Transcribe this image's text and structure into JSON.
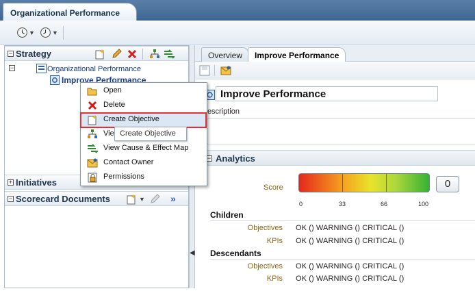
{
  "window": {
    "title_tab": "Organizational Performance"
  },
  "strategy": {
    "header": "Strategy",
    "tree": {
      "root": "Organizational Performance",
      "child": "Improve Performance"
    }
  },
  "initiatives": {
    "header": "Initiatives"
  },
  "scorecard_docs": {
    "header": "Scorecard Documents",
    "expand_label": "»"
  },
  "context_menu": {
    "items": [
      {
        "label": "Open",
        "icon": "open-folder-icon"
      },
      {
        "label": "Delete",
        "icon": "delete-x-icon"
      },
      {
        "label": "Create Objective",
        "icon": "create-objective-icon"
      },
      {
        "label": "View Strategy Tree",
        "icon": "strategy-tree-icon"
      },
      {
        "label": "View Cause & Effect Map",
        "icon": "cause-effect-map-icon"
      },
      {
        "label": "Contact Owner",
        "icon": "contact-owner-icon"
      },
      {
        "label": "Permissions",
        "icon": "permissions-icon"
      }
    ],
    "view_strategy_visible": "Vie",
    "tooltip": "Create Objective"
  },
  "right": {
    "tabs": {
      "overview": "Overview",
      "improve": "Improve Performance"
    },
    "objective_name": "Improve Performance",
    "description_label": "Description",
    "analytics_header": "Analytics",
    "score": {
      "label": "Score",
      "value": "0",
      "scale": [
        "0",
        "33",
        "66",
        "100"
      ]
    },
    "children": {
      "header": "Children",
      "rows": [
        {
          "label": "Objectives",
          "status": "OK ()  WARNING ()  CRITICAL ()"
        },
        {
          "label": "KPIs",
          "status": "OK ()  WARNING ()  CRITICAL ()"
        }
      ]
    },
    "descendants": {
      "header": "Descendants",
      "rows": [
        {
          "label": "Objectives",
          "status": "OK ()  WARNING ()  CRITICAL ()"
        },
        {
          "label": "KPIs",
          "status": "OK ()  WARNING ()  CRITICAL ()"
        }
      ]
    }
  },
  "colors": {
    "title_bar": "#3d6690",
    "highlight_border": "#e3303a",
    "gauge_red": "#e6271b",
    "gauge_yellow": "#e9e32b",
    "gauge_green": "#34b233",
    "label_gold": "#8a6512"
  }
}
